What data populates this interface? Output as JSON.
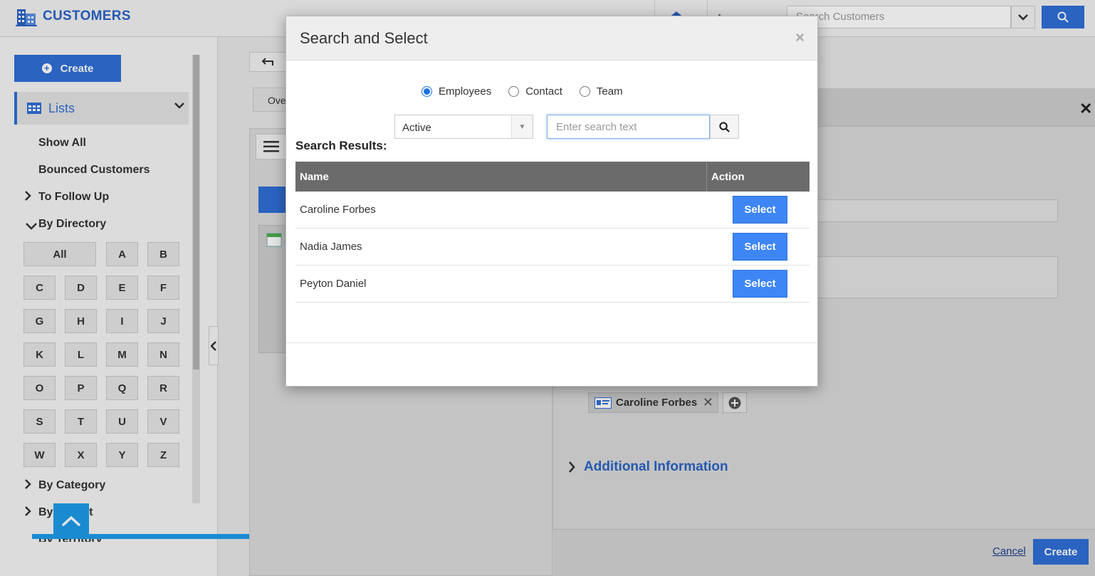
{
  "app": {
    "title": "CUSTOMERS",
    "search_placeholder": "Search Customers"
  },
  "sidebar": {
    "create_label": "Create",
    "lists_label": "Lists",
    "items": {
      "show_all": "Show All",
      "bounced": "Bounced Customers",
      "follow_up": "To Follow Up",
      "by_directory": "By Directory",
      "by_category": "By Category",
      "by_market": "By Market",
      "by_territory": "By Territory"
    },
    "letters": [
      "All",
      "A",
      "B",
      "C",
      "D",
      "E",
      "F",
      "G",
      "H",
      "I",
      "J",
      "K",
      "L",
      "M",
      "N",
      "O",
      "P",
      "Q",
      "R",
      "S",
      "T",
      "U",
      "V",
      "W",
      "X",
      "Y",
      "Z"
    ]
  },
  "middle": {
    "tab_label": "Ove"
  },
  "form": {
    "chip_label": "Caroline Forbes",
    "additional_info": "Additional Information",
    "cancel_label": "Cancel",
    "create_label": "Create"
  },
  "modal": {
    "title": "Search and Select",
    "close_glyph": "×",
    "radios": [
      {
        "label": "Employees",
        "checked": true
      },
      {
        "label": "Contact",
        "checked": false
      },
      {
        "label": "Team",
        "checked": false
      }
    ],
    "status_value": "Active",
    "search_placeholder": "Enter search text",
    "results_label": "Search Results:",
    "columns": {
      "name": "Name",
      "action": "Action"
    },
    "rows": [
      {
        "name": "Caroline Forbes",
        "action": "Select"
      },
      {
        "name": "Nadia James",
        "action": "Select"
      },
      {
        "name": "Peyton Daniel",
        "action": "Select"
      }
    ]
  },
  "colors": {
    "accent": "#2f6fd6",
    "select_button": "#3e86f5",
    "table_header": "#6b6b6b",
    "scroll_top": "#1e9be8"
  }
}
